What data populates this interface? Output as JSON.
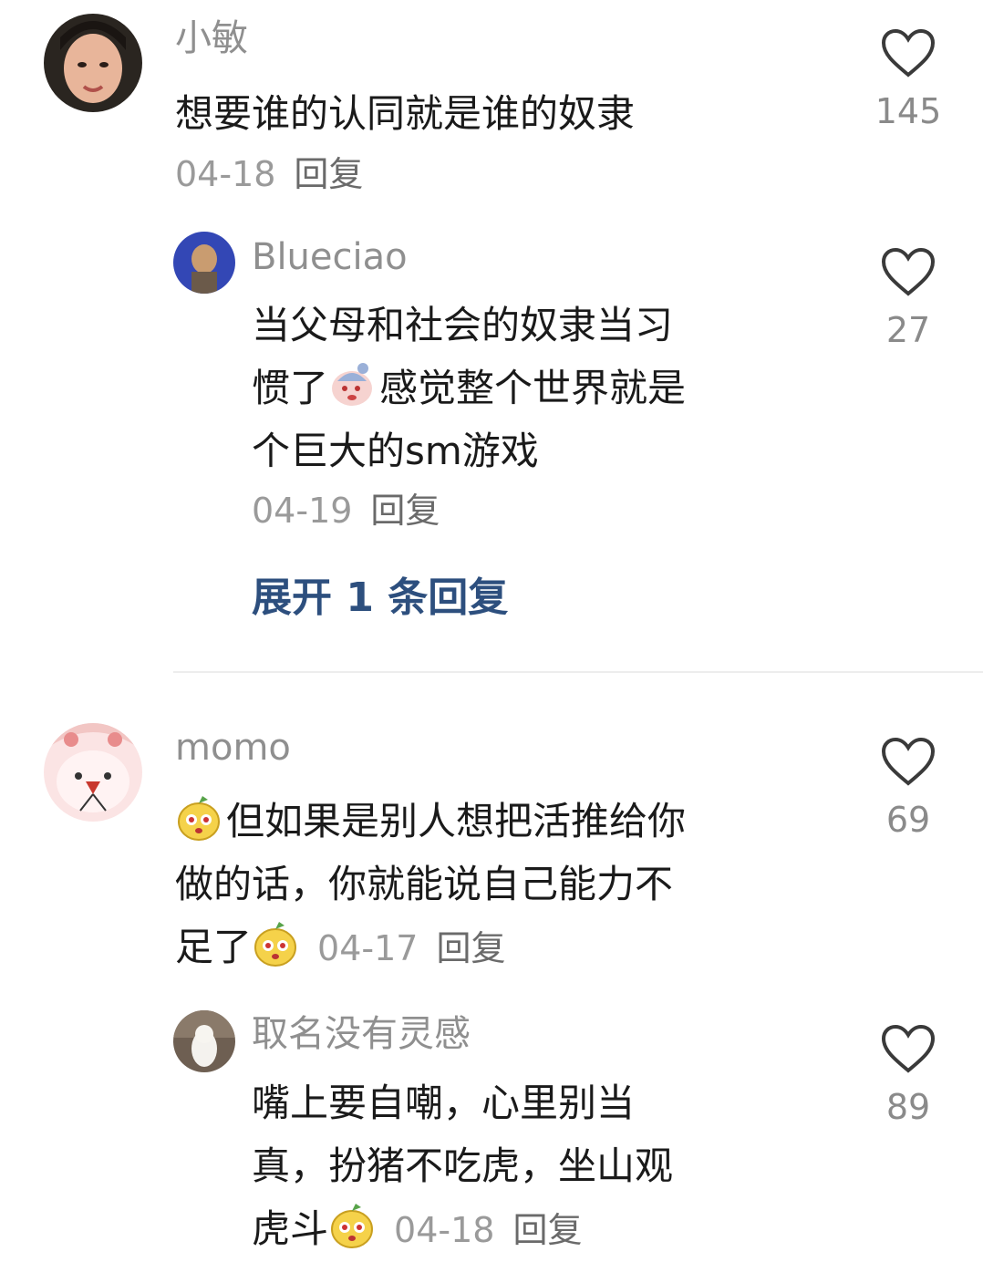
{
  "comments": [
    {
      "username": "小敏",
      "text": "想要谁的认同就是谁的奴隶",
      "date": "04-18",
      "reply_label": "回复",
      "likes": "145",
      "replies": [
        {
          "username": "Blueciao",
          "text_line1": "当父母和社会的奴隶当习",
          "text_line2_a": "惯了",
          "text_line2_b": "感觉整个世界就是",
          "text_line3": "个巨大的sm游戏",
          "date": "04-19",
          "reply_label": "回复",
          "likes": "27"
        }
      ],
      "expand_label": "展开 1 条回复"
    },
    {
      "username": "momo",
      "text_line1": "但如果是别人想把活推给你",
      "text_line2": "做的话，你就能说自己能力不",
      "text_line3": "足了",
      "date": "04-17",
      "reply_label": "回复",
      "likes": "69",
      "replies": [
        {
          "username": "取名没有灵感",
          "text_line1": "嘴上要自嘲，心里别当",
          "text_line2": "真，扮猪不吃虎，坐山观",
          "text_line3": "虎斗",
          "date": "04-18",
          "reply_label": "回复",
          "likes": "89"
        }
      ]
    }
  ],
  "colors": {
    "link": "#2d4f7e",
    "muted": "#8f8f8f"
  },
  "icons": [
    "heart-outline-icon",
    "pear-face-emoji",
    "distressed-face-emoji"
  ]
}
